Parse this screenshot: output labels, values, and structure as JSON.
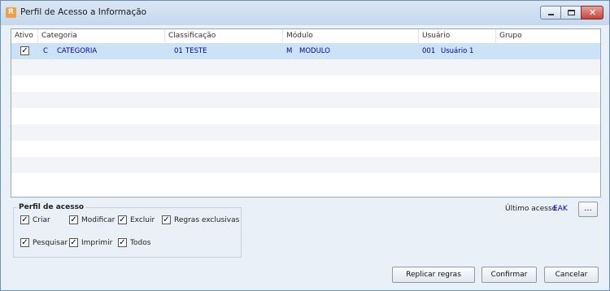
{
  "window": {
    "title": "Perfil de Acesso a Informação",
    "app_icon_glyph": "R",
    "app_icon_color": "#f0a040",
    "close_glyph": "✕"
  },
  "grid": {
    "columns": [
      "Ativo",
      "Categoria",
      "Classificação",
      "Módulo",
      "Usuário",
      "Grupo"
    ],
    "rows": [
      {
        "ativo_checked": true,
        "categoria_code": "C",
        "categoria_name": "CATEGORIA",
        "classificacao_code": "01",
        "classificacao_name": "TESTE",
        "modulo_code": "M",
        "modulo_name": "MODULO",
        "usuario_code": "001",
        "usuario_name": "Usuário 1",
        "grupo": ""
      }
    ]
  },
  "perfil": {
    "title": "Perfil de acesso",
    "options": [
      {
        "label": "Criar",
        "checked": true
      },
      {
        "label": "Modificar",
        "checked": true
      },
      {
        "label": "Excluir",
        "checked": true
      },
      {
        "label": "Regras exclusivas",
        "checked": true
      },
      {
        "label": "Pesquisar",
        "checked": true
      },
      {
        "label": "Imprimir",
        "checked": true
      },
      {
        "label": "Todos",
        "checked": true
      }
    ]
  },
  "ultimo_acesso": {
    "label": "Último acesso",
    "value": "EAK",
    "browse_label": "..."
  },
  "buttons": {
    "replicar": "Replicar regras",
    "confirmar": "Confirmar",
    "cancelar": "Cancelar"
  },
  "colors": {
    "selected_row": "#cce2f6",
    "data_text": "#0000a8",
    "alt_row": "#f2f4f8"
  },
  "check_glyph": "✓"
}
